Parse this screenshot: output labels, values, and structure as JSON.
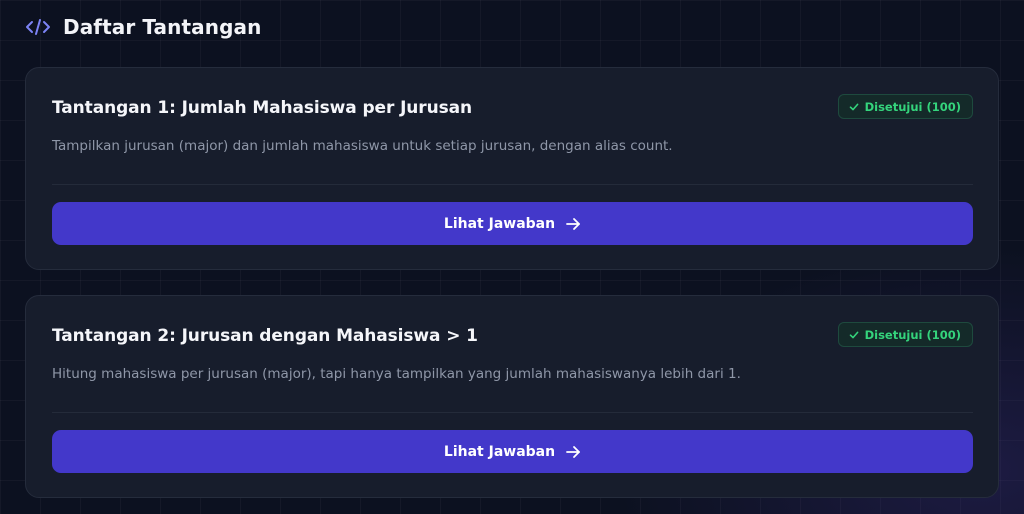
{
  "header": {
    "title": "Daftar Tantangan",
    "icon": "code-icon"
  },
  "colors": {
    "accent": "#4338ca",
    "success": "#34d47c",
    "background": "#0c1120",
    "card": "#171d2c"
  },
  "challenges": [
    {
      "title": "Tantangan 1: Jumlah Mahasiswa per Jurusan",
      "description": "Tampilkan jurusan (major) dan jumlah mahasiswa untuk setiap jurusan, dengan alias count.",
      "status": "Disetujui (100)",
      "button_label": "Lihat Jawaban"
    },
    {
      "title": "Tantangan 2: Jurusan dengan Mahasiswa > 1",
      "description": "Hitung mahasiswa per jurusan (major), tapi hanya tampilkan yang jumlah mahasiswanya lebih dari 1.",
      "status": "Disetujui (100)",
      "button_label": "Lihat Jawaban"
    }
  ]
}
